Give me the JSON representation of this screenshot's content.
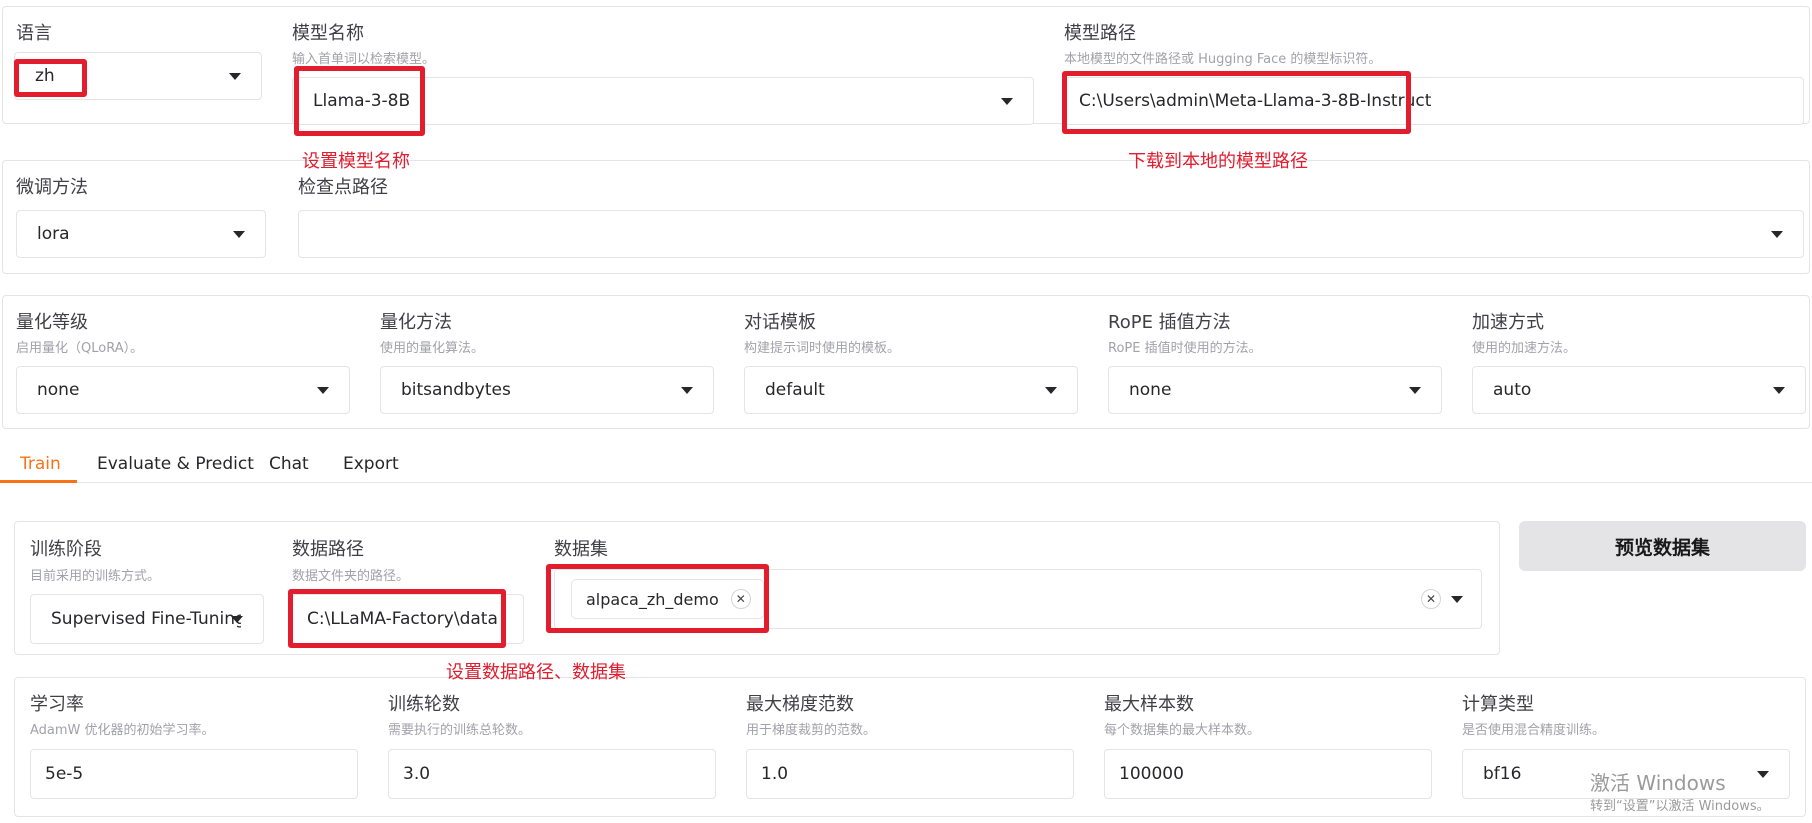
{
  "top": {
    "language": {
      "label": "语言",
      "value": "zh"
    },
    "model_name": {
      "label": "模型名称",
      "hint": "输入首单词以检索模型。",
      "value": "Llama-3-8B"
    },
    "model_path": {
      "label": "模型路径",
      "hint": "本地模型的文件路径或 Hugging Face 的模型标识符。",
      "value": "C:\\Users\\admin\\Meta-Llama-3-8B-Instruct"
    }
  },
  "finetune": {
    "method": {
      "label": "微调方法",
      "value": "lora"
    },
    "checkpoint": {
      "label": "检查点路径",
      "value": ""
    }
  },
  "advanced": [
    {
      "label": "量化等级",
      "hint": "启用量化（QLoRA）。",
      "value": "none"
    },
    {
      "label": "量化方法",
      "hint": "使用的量化算法。",
      "value": "bitsandbytes"
    },
    {
      "label": "对话模板",
      "hint": "构建提示词时使用的模板。",
      "value": "default"
    },
    {
      "label": "RoPE 插值方法",
      "hint": "RoPE 插值时使用的方法。",
      "value": "none"
    },
    {
      "label": "加速方式",
      "hint": "使用的加速方法。",
      "value": "auto"
    }
  ],
  "tabs": [
    {
      "label": "Train",
      "active": true
    },
    {
      "label": "Evaluate & Predict"
    },
    {
      "label": "Chat"
    },
    {
      "label": "Export"
    }
  ],
  "train": {
    "stage": {
      "label": "训练阶段",
      "hint": "目前采用的训练方式。",
      "value": "Supervised Fine-Tuning"
    },
    "data_path": {
      "label": "数据路径",
      "hint": "数据文件夹的路径。",
      "value": "C:\\LLaMA-Factory\\data"
    },
    "dataset": {
      "label": "数据集",
      "chip": "alpaca_zh_demo"
    },
    "preview_button": "预览数据集"
  },
  "params": [
    {
      "label": "学习率",
      "hint": "AdamW 优化器的初始学习率。",
      "value": "5e-5"
    },
    {
      "label": "训练轮数",
      "hint": "需要执行的训练总轮数。",
      "value": "3.0"
    },
    {
      "label": "最大梯度范数",
      "hint": "用于梯度裁剪的范数。",
      "value": "1.0"
    },
    {
      "label": "最大样本数",
      "hint": "每个数据集的最大样本数。",
      "value": "100000"
    },
    {
      "label": "计算类型",
      "hint": "是否使用混合精度训练。",
      "value": "bf16"
    }
  ],
  "annotations": {
    "model_name": "设置模型名称",
    "model_path": "下载到本地的模型路径",
    "data": "设置数据路径、数据集"
  },
  "watermark": {
    "line1": "激活 Windows",
    "line2": "转到“设置”以激活 Windows。"
  },
  "colors": {
    "accent": "#f97316",
    "annotation_red": "#e11d2e"
  }
}
